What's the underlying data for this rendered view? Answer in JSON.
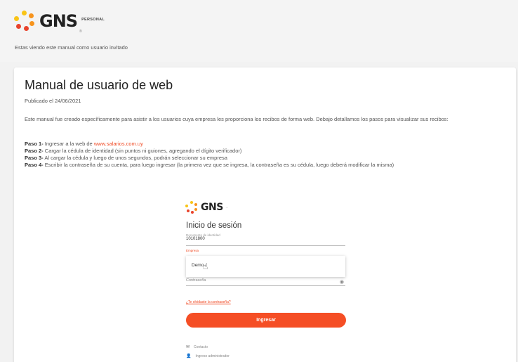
{
  "header": {
    "brand": "GNS",
    "brand_sub": "PERSONAL",
    "brand_reg": "®",
    "guest_note": "Estas viendo este manual como usuario invitado"
  },
  "article": {
    "title": "Manual de usuario de web",
    "published": "Publicado el 24/06/2021",
    "intro": "Este manual fue creado específicamente para asistir a los usuarios cuya empresa les proporciona los recibos de forma web. Debajo detallamos los pasos para visualizar sus recibos:",
    "steps": [
      {
        "label": "Paso 1-",
        "text": " Ingresar a la web de ",
        "link": "www.salarios.com.uy"
      },
      {
        "label": "Paso 2-",
        "text": " Cargar la cédula de identidad (sin puntos ni guiones, agregando el dígito verificador)"
      },
      {
        "label": "Paso 3-",
        "text": " Al cargar la cédula y luego de unos segundos, podrán seleccionar su empresa"
      },
      {
        "label": "Paso 4-",
        "text": " Escribir la contraseña de su cuenta, para luego ingresar (la primera vez que se ingresa, la contraseña es su cédula, luego deberá modificar la misma)"
      }
    ]
  },
  "screenshot": {
    "brand": "GNS",
    "heading": "Inicio de sesión",
    "doc_label": "Documento de identidad",
    "doc_value": "10101800",
    "company_label": "Empresa",
    "dropdown_option": "Demo",
    "password_label": "Contraseña",
    "forgot": "¿Te olvidaste la contraseña?",
    "login_button": "Ingresar",
    "contact": "Contacto",
    "admin": "Ingreso administrador"
  },
  "colors": {
    "accent": "#f54e25",
    "logo_orange": "#f7941d",
    "logo_red": "#e8432c",
    "logo_yellow": "#f9c416"
  }
}
